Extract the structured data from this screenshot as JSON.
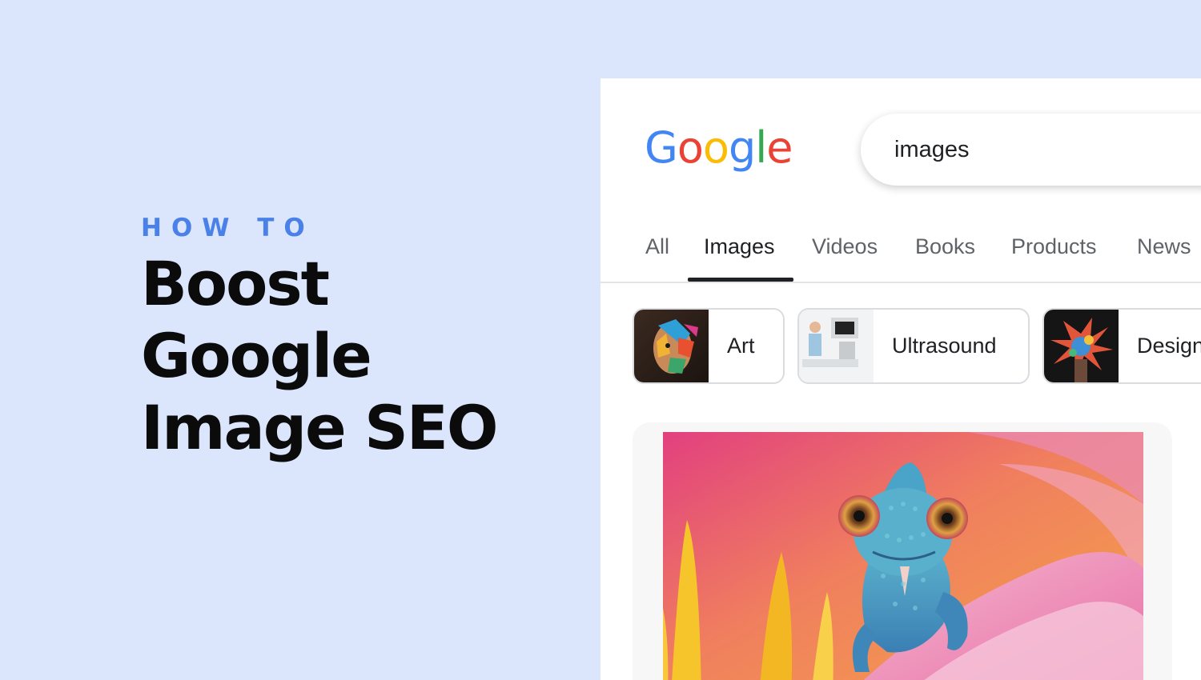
{
  "hero": {
    "kicker": "HOW TO",
    "headline_lines": [
      "Boost",
      "Google",
      "Image SEO"
    ]
  },
  "search": {
    "logo_text": "Google",
    "query": "images"
  },
  "tabs": [
    {
      "label": "All",
      "active": false
    },
    {
      "label": "Images",
      "active": true
    },
    {
      "label": "Videos",
      "active": false
    },
    {
      "label": "Books",
      "active": false
    },
    {
      "label": "Products",
      "active": false
    },
    {
      "label": "News",
      "active": false
    }
  ],
  "chips": [
    {
      "label": "Art",
      "thumb": "colorful-face-art-thumbnail"
    },
    {
      "label": "Ultrasound",
      "thumb": "ultrasound-machine-thumbnail"
    },
    {
      "label": "Design",
      "thumb": "paint-splash-design-thumbnail"
    }
  ],
  "result": {
    "image": "blue-chameleon-on-pink-flower"
  },
  "colors": {
    "background": "#dbe6fc",
    "accent": "#4a81e8",
    "google_blue": "#4285f4",
    "google_red": "#ea4335",
    "google_yellow": "#fbbc05",
    "google_green": "#34a853"
  }
}
